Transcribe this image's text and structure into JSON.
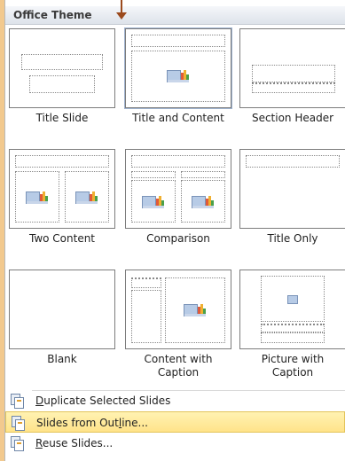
{
  "gallery": {
    "header": "Office Theme",
    "layouts": [
      {
        "label": "Title Slide"
      },
      {
        "label": "Title and Content"
      },
      {
        "label": "Section Header"
      },
      {
        "label": "Two Content"
      },
      {
        "label": "Comparison"
      },
      {
        "label": "Title Only"
      },
      {
        "label": "Blank"
      },
      {
        "label": "Content with\nCaption"
      },
      {
        "label": "Picture with\nCaption"
      }
    ]
  },
  "menu": {
    "items": [
      {
        "pre": "",
        "accel": "D",
        "post": "uplicate Selected Slides",
        "highlighted": false,
        "icon": "duplicate-slides-icon"
      },
      {
        "pre": "Slides from Out",
        "accel": "l",
        "post": "ine...",
        "highlighted": true,
        "icon": "slides-from-outline-icon"
      },
      {
        "pre": "",
        "accel": "R",
        "post": "euse Slides...",
        "highlighted": false,
        "icon": "reuse-slides-icon"
      }
    ]
  },
  "colors": {
    "background": "#f2c98e",
    "highlight": "#ffe38a",
    "arrow": "#9b4a1d"
  }
}
